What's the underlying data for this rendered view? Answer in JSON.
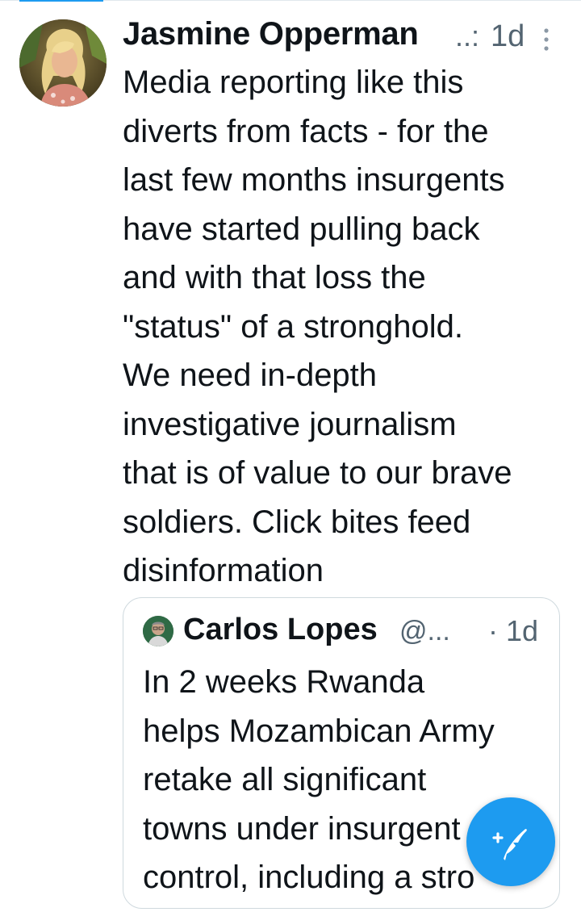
{
  "tweet": {
    "author_name": "Jasmine Opperman",
    "handle_truncated": "..:",
    "time": "1d",
    "text_lines": [
      "Media reporting like this",
      "diverts from facts - for the",
      "last few months insurgents",
      "have started pulling back",
      "and with that loss the",
      "\"status\" of a stronghold.",
      "We need in-depth",
      "investigative journalism",
      "that is of value to our brave",
      "soldiers. Click bites feed",
      "disinformation"
    ]
  },
  "quote": {
    "author_name": "Carlos Lopes",
    "handle_truncated": "@...",
    "time": "· 1d",
    "text_lines": [
      "In 2 weeks Rwanda",
      "helps Mozambican Army",
      "retake all significant",
      "towns under insurgent",
      "control, including a stro"
    ]
  },
  "icons": {
    "more": "more-vertical-icon",
    "compose": "compose-tweet-icon"
  },
  "colors": {
    "accent": "#1d9bf0",
    "text_primary": "#0f1419",
    "text_secondary": "#536471",
    "border": "#cfd9de"
  }
}
